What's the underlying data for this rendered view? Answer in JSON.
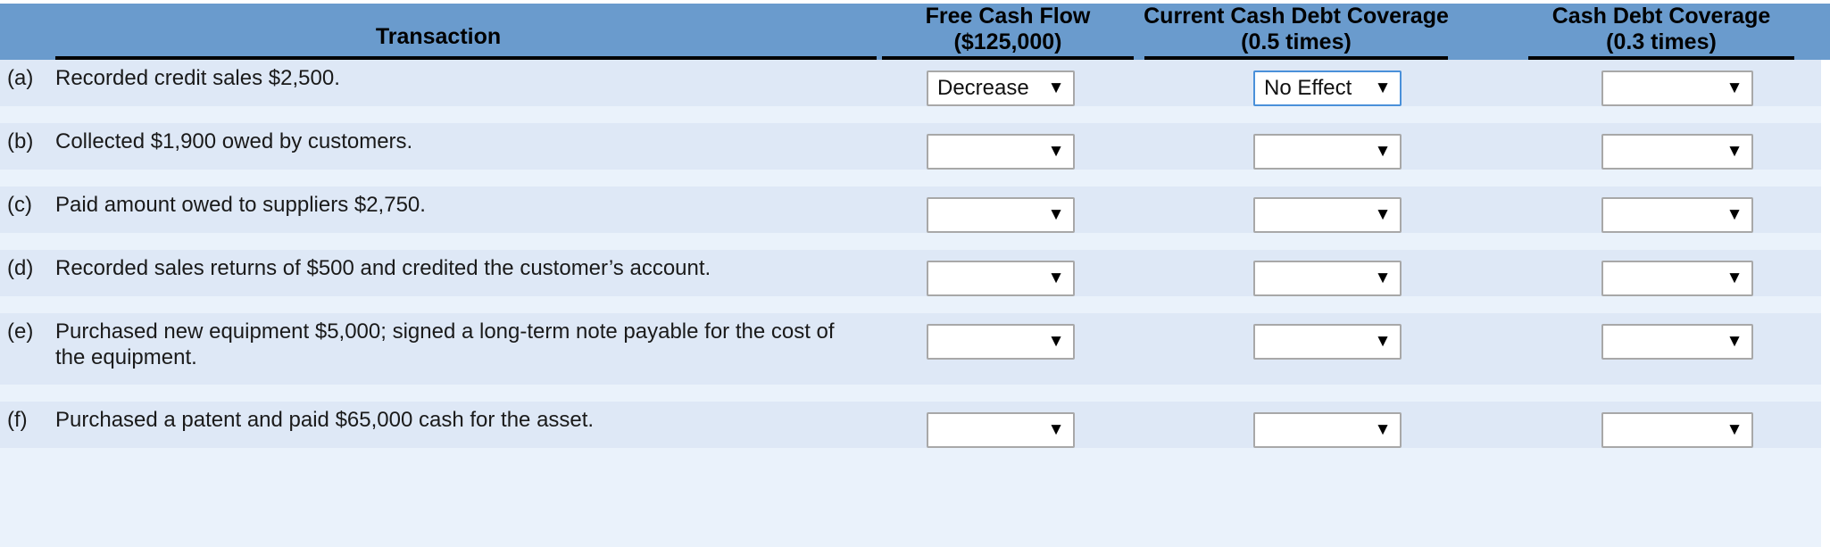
{
  "table": {
    "headers": [
      {
        "id": "transaction",
        "line1": "Transaction",
        "line2": ""
      },
      {
        "id": "free_cash_flow",
        "line1": "Free Cash Flow",
        "line2": "($125,000)"
      },
      {
        "id": "current_cash_debt_coverage",
        "line1": "Current Cash Debt Coverage",
        "line2": "(0.5 times)"
      },
      {
        "id": "cash_debt_coverage",
        "line1": "Cash Debt Coverage",
        "line2": "(0.3 times)"
      }
    ],
    "rows": [
      {
        "letter": "(a)",
        "text": "Recorded credit sales $2,500.",
        "free_cash_flow": "Decrease",
        "current_cash_debt_coverage": "No Effect",
        "cash_debt_coverage": "",
        "focused_column": "current_cash_debt_coverage"
      },
      {
        "letter": "(b)",
        "text": "Collected $1,900 owed by customers.",
        "free_cash_flow": "",
        "current_cash_debt_coverage": "",
        "cash_debt_coverage": "",
        "focused_column": ""
      },
      {
        "letter": "(c)",
        "text": "Paid amount owed to suppliers $2,750.",
        "free_cash_flow": "",
        "current_cash_debt_coverage": "",
        "cash_debt_coverage": "",
        "focused_column": ""
      },
      {
        "letter": "(d)",
        "text": "Recorded sales returns of $500 and credited the customer’s account.",
        "free_cash_flow": "",
        "current_cash_debt_coverage": "",
        "cash_debt_coverage": "",
        "focused_column": ""
      },
      {
        "letter": "(e)",
        "text": "Purchased new equipment $5,000; signed a long-term note payable for the cost of the equipment.",
        "free_cash_flow": "",
        "current_cash_debt_coverage": "",
        "cash_debt_coverage": "",
        "focused_column": ""
      },
      {
        "letter": "(f)",
        "text": "Purchased a patent and paid $65,000 cash for the asset.",
        "free_cash_flow": "",
        "current_cash_debt_coverage": "",
        "cash_debt_coverage": "",
        "focused_column": ""
      }
    ],
    "dropdown_caret_glyph": "▼"
  },
  "colors": {
    "header_background": "#6a9bcd",
    "row_band_dark": "#dee8f6",
    "row_band_light": "#eaf2fb",
    "dropdown_border": "#a8a8a8",
    "dropdown_border_focused": "#4a90d9",
    "rule": "#000000"
  }
}
